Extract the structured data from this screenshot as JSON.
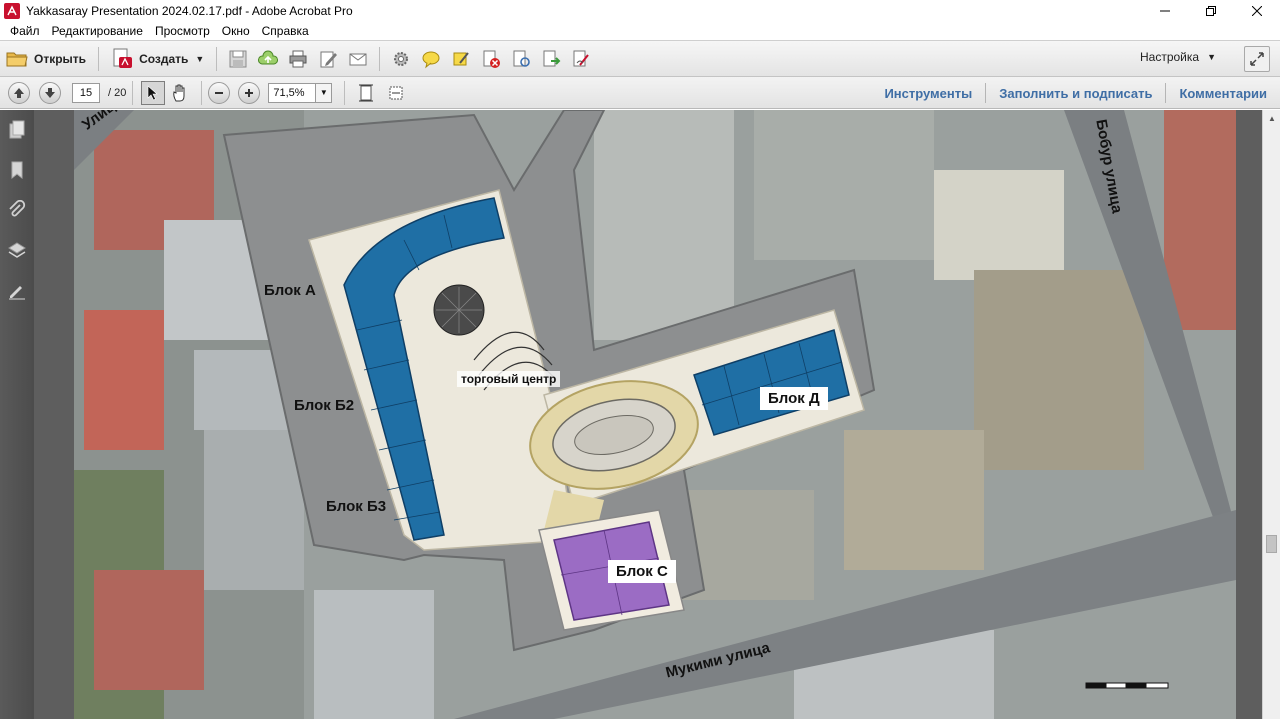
{
  "window": {
    "title": "Yakkasaray Presentation 2024.02.17.pdf - Adobe Acrobat Pro"
  },
  "menu": {
    "items": [
      "Файл",
      "Редактирование",
      "Просмотр",
      "Окно",
      "Справка"
    ]
  },
  "toolbar": {
    "open_label": "Открыть",
    "create_label": "Создать",
    "settings_label": "Настройка"
  },
  "nav": {
    "current_page": "15",
    "total_pages": "/ 20",
    "zoom": "71,5%"
  },
  "panels": {
    "tools": "Инструменты",
    "fill_sign": "Заполнить и подписать",
    "comments": "Комментарии"
  },
  "map": {
    "street_left": "Улица",
    "street_right": "Бобур улица",
    "street_bottom": "Мукими улица",
    "block_a": "Блок А",
    "block_b2": "Блок Б2",
    "block_b3": "Блок Б3",
    "block_d": "Блок Д",
    "block_c": "Блок С",
    "shopping_center": "торговый центр"
  },
  "colors": {
    "accent_link": "#3f6ea5",
    "block_blue": "#1f6fa5",
    "block_purple": "#9b6cc4"
  }
}
